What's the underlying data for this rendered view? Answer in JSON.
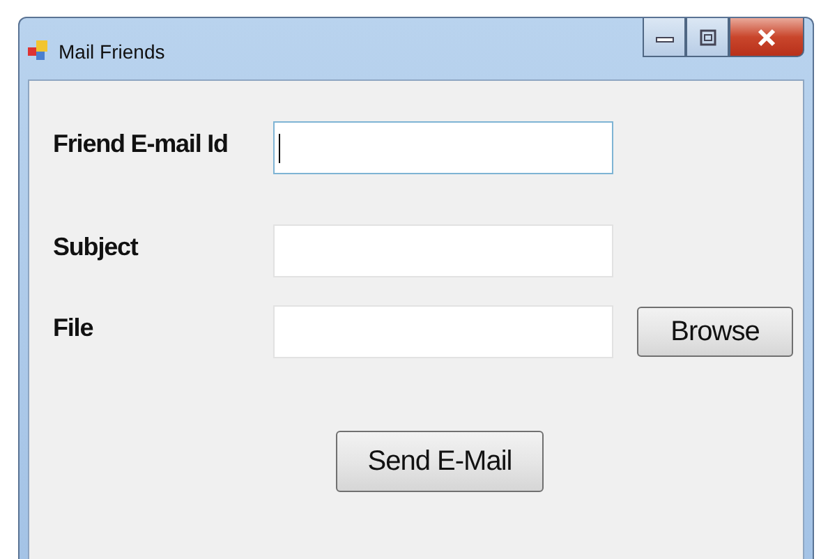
{
  "window": {
    "title": "Mail Friends"
  },
  "fields": [
    {
      "label": "Friend E-mail Id",
      "focused": true
    },
    {
      "label": "Subject",
      "focused": false
    },
    {
      "label": "File",
      "focused": false,
      "button": "Browse"
    }
  ],
  "submit": "Send E-Mail"
}
